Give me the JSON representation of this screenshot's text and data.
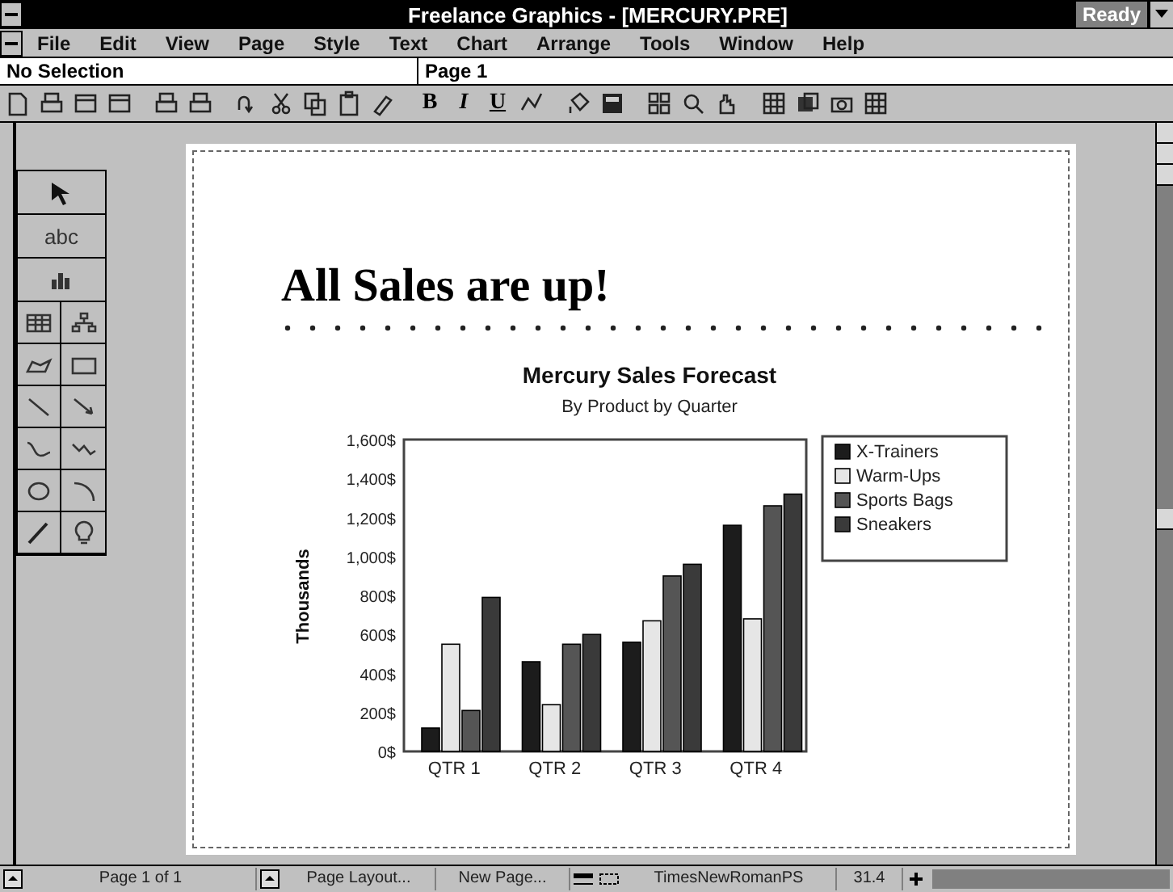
{
  "window": {
    "title": "Freelance Graphics - [MERCURY.PRE]",
    "status": "Ready"
  },
  "menu": [
    "File",
    "Edit",
    "View",
    "Page",
    "Style",
    "Text",
    "Chart",
    "Arrange",
    "Tools",
    "Window",
    "Help"
  ],
  "selection_field": {
    "value": "No Selection"
  },
  "page_field": {
    "value": "Page 1"
  },
  "format_buttons": [
    "B",
    "I",
    "U"
  ],
  "toolbox": {
    "text_tool": "abc"
  },
  "page": {
    "heading": "All Sales are up!",
    "chart": {
      "chart_data": {
        "type": "bar",
        "title": "Mercury Sales Forecast",
        "subtitle": "By Product by Quarter",
        "ylabel": "Thousands",
        "categories": [
          "QTR 1",
          "QTR 2",
          "QTR 3",
          "QTR 4"
        ],
        "series": [
          {
            "name": "X-Trainers",
            "color": "#1c1c1c",
            "values": [
              120,
              460,
              560,
              1160
            ]
          },
          {
            "name": "Warm-Ups",
            "color": "#e6e6e6",
            "values": [
              550,
              240,
              670,
              680
            ]
          },
          {
            "name": "Sports Bags",
            "color": "#555555",
            "values": [
              210,
              550,
              900,
              1260
            ]
          },
          {
            "name": "Sneakers",
            "color": "#3a3a3a",
            "values": [
              790,
              600,
              960,
              1320
            ]
          }
        ],
        "legend": true,
        "ylim": [
          0,
          1600
        ],
        "yticks": [
          {
            "value": 0,
            "label": "0$"
          },
          {
            "value": 200,
            "label": "200$"
          },
          {
            "value": 400,
            "label": "400$"
          },
          {
            "value": 600,
            "label": "600$"
          },
          {
            "value": 800,
            "label": "800$"
          },
          {
            "value": 1000,
            "label": "1,000$"
          },
          {
            "value": 1200,
            "label": "1,200$"
          },
          {
            "value": 1400,
            "label": "1,400$"
          },
          {
            "value": 1600,
            "label": "1,600$"
          }
        ]
      }
    }
  },
  "status_bar": [
    "Page 1 of 1",
    "Page Layout...",
    "New Page...",
    "TimesNewRomanPS",
    "31.4"
  ]
}
